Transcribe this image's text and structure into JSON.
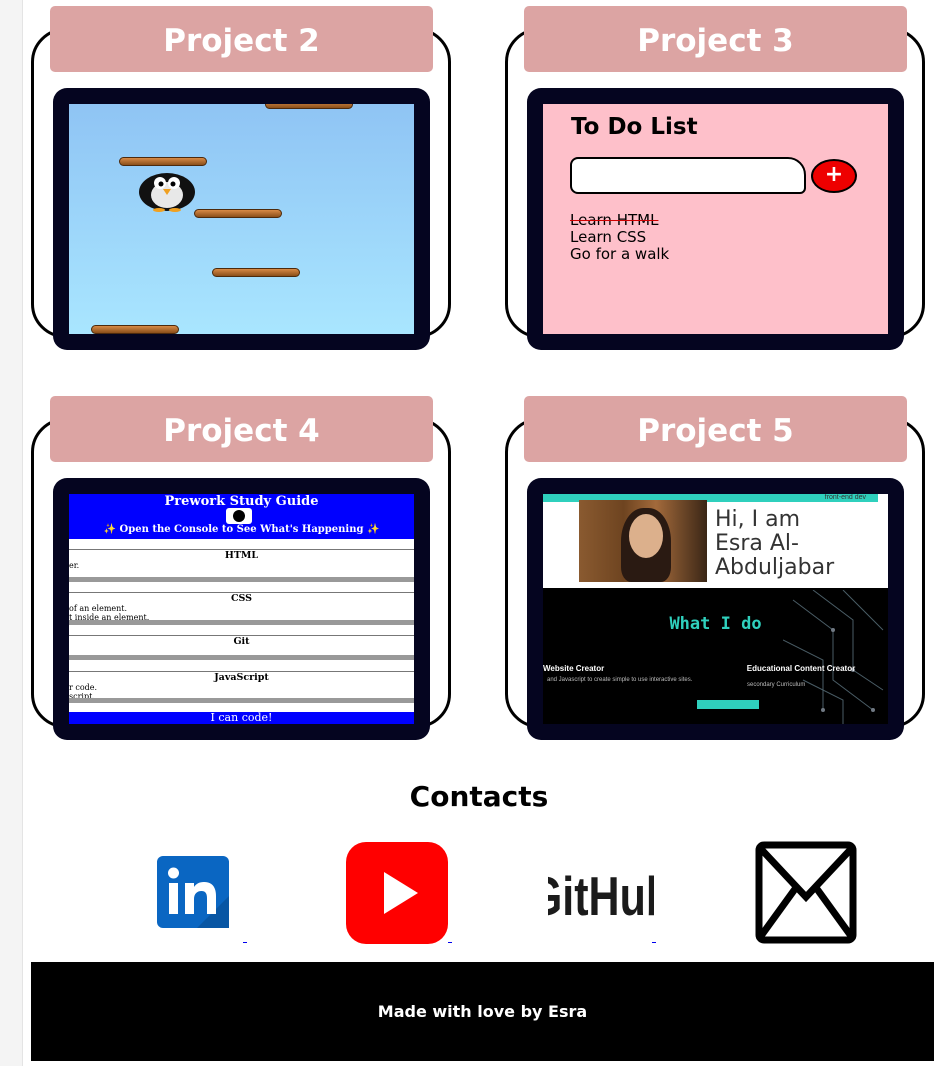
{
  "projects": [
    {
      "title": "Project 2"
    },
    {
      "title": "Project 3",
      "todo": {
        "title": "To Do List",
        "add_label": "+",
        "items": [
          "Learn HTML",
          "Learn CSS",
          "Go for a walk"
        ]
      }
    },
    {
      "title": "Project 4",
      "guide": {
        "title": "Prework Study Guide",
        "subtitle": "✨ Open the Console to See What's Happening ✨",
        "sections": [
          {
            "heading": "HTML",
            "lines": [
              "er."
            ]
          },
          {
            "heading": "CSS",
            "lines": [
              "of an element.",
              "t inside an element."
            ]
          },
          {
            "heading": "Git",
            "lines": []
          },
          {
            "heading": "JavaScript",
            "lines": [
              "r code.",
              " script."
            ]
          }
        ],
        "footer": "I can code!"
      }
    },
    {
      "title": "Project 5",
      "portfolio": {
        "strip_text": "front-end dev",
        "greeting": "Hi, I am Esra Al-Abduljabar",
        "section_title": "What I do",
        "col1_title": "Website Creator",
        "col1_desc": "and Javascript to create simple to use interactive sites.",
        "col2_title": "Educational Content Creator",
        "col2_desc": "secondary Curriculum"
      }
    }
  ],
  "contacts": {
    "title": "Contacts",
    "items": [
      {
        "name": "LinkedIn",
        "icon": "linkedin-icon",
        "color": "#0a66c2"
      },
      {
        "name": "YouTube",
        "icon": "youtube-icon",
        "color": "#ff0000"
      },
      {
        "name": "GitHub",
        "icon": "github-icon",
        "label": "GitHub"
      },
      {
        "name": "Email",
        "icon": "mail-icon"
      }
    ]
  },
  "footer": {
    "text": "Made with love by Esra"
  },
  "colors": {
    "title_bg": "#dca4a3",
    "frame_bg": "#050520",
    "teal": "#2fd0bd"
  }
}
